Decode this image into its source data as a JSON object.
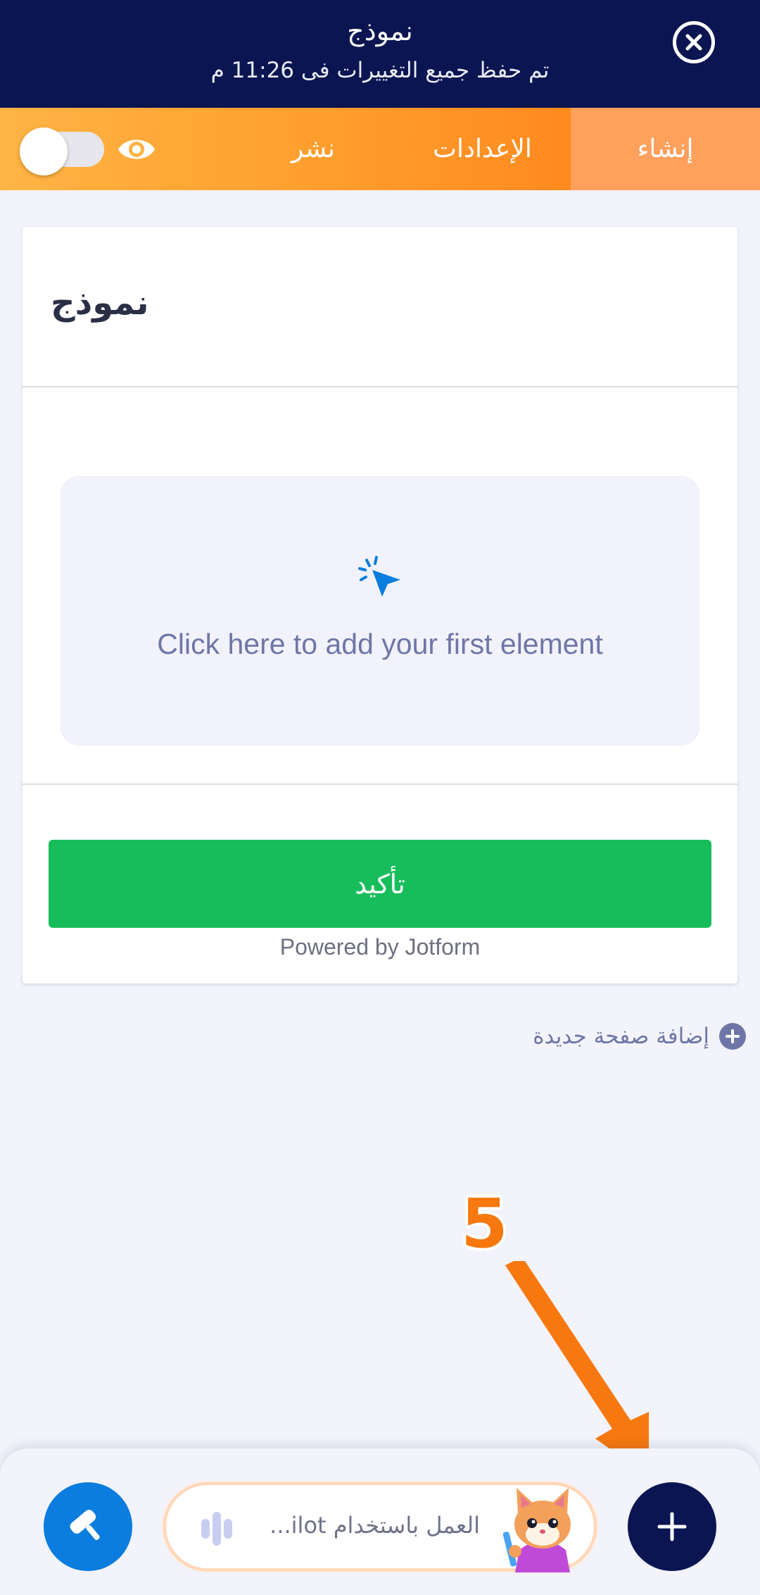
{
  "header": {
    "title": "نموذج",
    "subtitle": "تم حفظ جميع التغييرات فى 11:26 م"
  },
  "tabs": [
    {
      "label": "إنشاء",
      "active": true
    },
    {
      "label": "الإعدادات",
      "active": false
    },
    {
      "label": "نشر",
      "active": false
    }
  ],
  "preview_toggle": {
    "on": false
  },
  "form": {
    "title": "نموذج",
    "empty_prompt": "Click here to add your first element",
    "submit_label": "تأكيد",
    "powered_by": "Powered by Jotform"
  },
  "add_page_label": "إضافة صفحة جديدة",
  "annotation": {
    "step": "5",
    "color": "#f7780f"
  },
  "bottom_bar": {
    "ai_placeholder": "العمل باستخدام ilot..."
  },
  "colors": {
    "header_bg": "#0a1551",
    "accent_orange": "#ff9a2a",
    "submit_green": "#18bd5b",
    "design_blue": "#0a7ddf"
  },
  "icons": [
    "close-icon",
    "eye-icon",
    "pointer-click-icon",
    "plus-circle-icon",
    "paint-roller-icon",
    "waveform-icon",
    "mascot-icon",
    "plus-icon"
  ]
}
